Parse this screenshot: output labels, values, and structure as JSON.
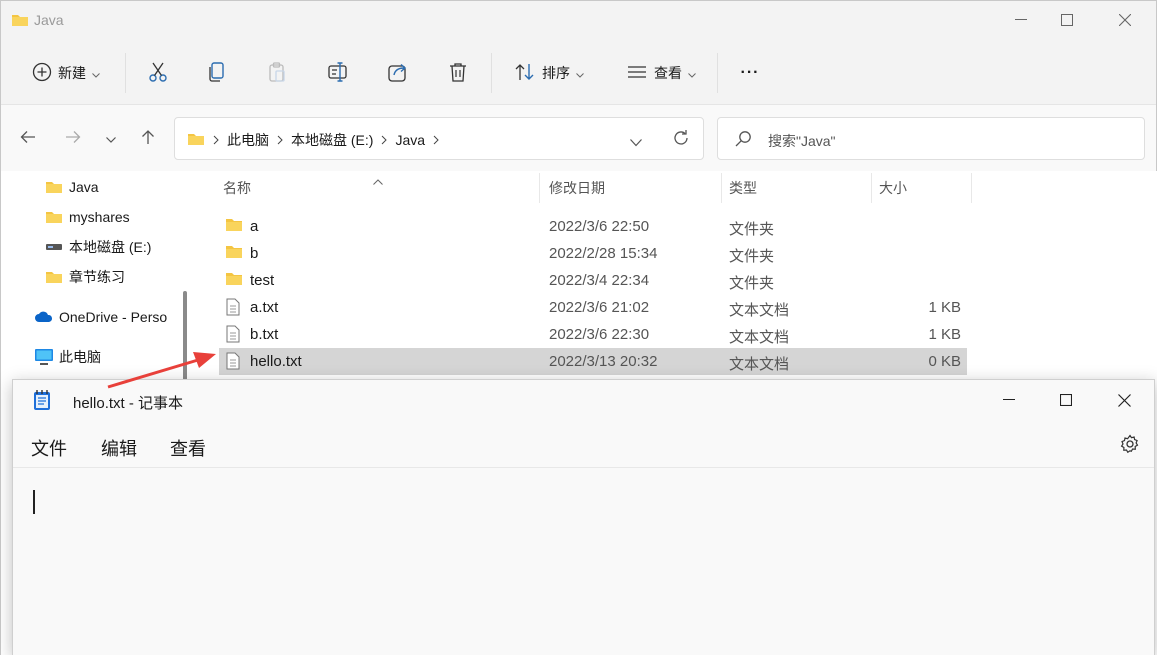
{
  "explorer": {
    "title": "Java",
    "toolbar": {
      "new_label": "新建",
      "sort_label": "排序",
      "view_label": "查看",
      "more_label": "···"
    },
    "breadcrumb": [
      "此电脑",
      "本地磁盘 (E:)",
      "Java"
    ],
    "search_placeholder": "搜索\"Java\"",
    "nav_items": [
      {
        "label": "Java",
        "icon": "folder-icon"
      },
      {
        "label": "myshares",
        "icon": "folder-icon"
      },
      {
        "label": "本地磁盘 (E:)",
        "icon": "drive-icon"
      },
      {
        "label": "章节练习",
        "icon": "folder-icon"
      },
      {
        "label": "OneDrive - Perso",
        "icon": "onedrive-icon"
      },
      {
        "label": "此电脑",
        "icon": "computer-icon"
      }
    ],
    "columns": {
      "name": "名称",
      "date": "修改日期",
      "type": "类型",
      "size": "大小"
    },
    "files": [
      {
        "name": "a",
        "date": "2022/3/6 22:50",
        "type": "文件夹",
        "size": "",
        "icon": "folder-icon"
      },
      {
        "name": "b",
        "date": "2022/2/28 15:34",
        "type": "文件夹",
        "size": "",
        "icon": "folder-icon"
      },
      {
        "name": "test",
        "date": "2022/3/4 22:34",
        "type": "文件夹",
        "size": "",
        "icon": "folder-icon"
      },
      {
        "name": "a.txt",
        "date": "2022/3/6 21:02",
        "type": "文本文档",
        "size": "1 KB",
        "icon": "text-file-icon"
      },
      {
        "name": "b.txt",
        "date": "2022/3/6 22:30",
        "type": "文本文档",
        "size": "1 KB",
        "icon": "text-file-icon"
      },
      {
        "name": "hello.txt",
        "date": "2022/3/13 20:32",
        "type": "文本文档",
        "size": "0 KB",
        "icon": "text-file-icon",
        "selected": true
      }
    ]
  },
  "notepad": {
    "title": "hello.txt - 记事本",
    "menu": [
      "文件",
      "编辑",
      "查看"
    ],
    "content": ""
  },
  "colors": {
    "folder": "#f4c542",
    "selection": "#d5d5d5",
    "arrow": "#e8403a",
    "accent": "#0067c0"
  }
}
